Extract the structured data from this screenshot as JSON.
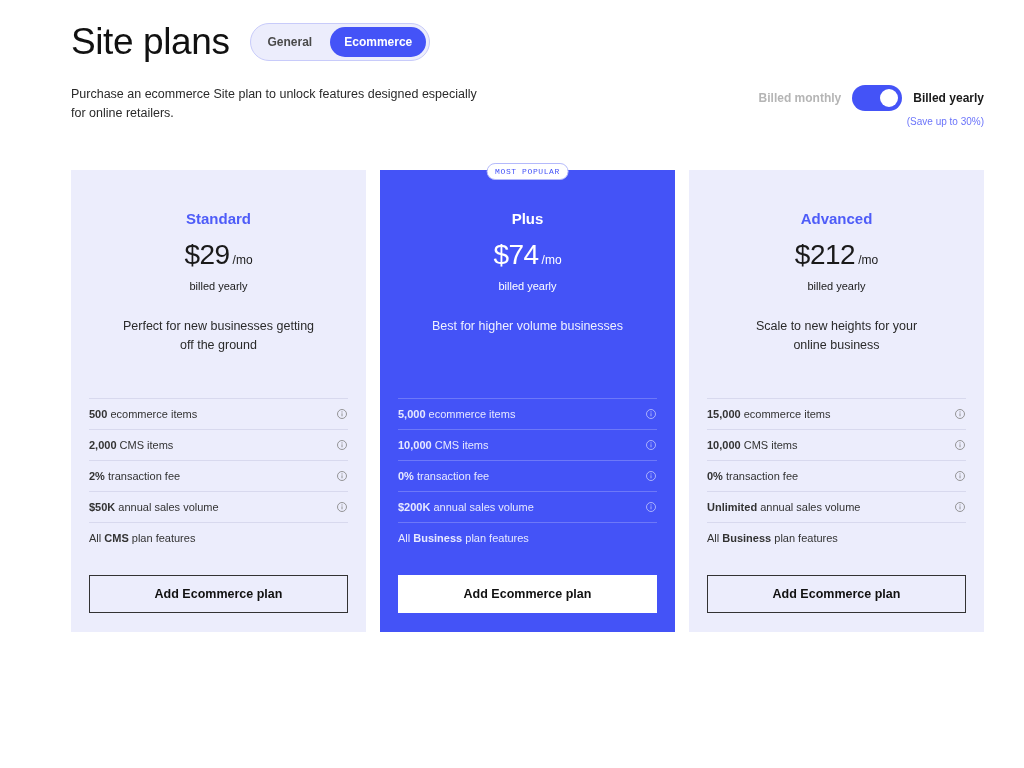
{
  "title": "Site plans",
  "tabs": [
    {
      "label": "General",
      "selected": false
    },
    {
      "label": "Ecommerce",
      "selected": true
    }
  ],
  "description": "Purchase an ecommerce Site plan to unlock features designed especially for online retailers.",
  "billing": {
    "monthly_label": "Billed monthly",
    "yearly": true,
    "yearly_label": "Billed yearly",
    "note": "(Save up to 30%)"
  },
  "plans": [
    {
      "name": "Standard",
      "price": "$29",
      "period": "/mo",
      "billing_note": "billed yearly",
      "description": "Perfect for new businesses getting off the ground",
      "featured": false,
      "features": [
        {
          "text": "**500** ecommerce items",
          "info": true
        },
        {
          "text": "**2,000** CMS items",
          "info": true
        },
        {
          "text": "**2%** transaction fee",
          "info": true
        },
        {
          "text": "**$50K** annual sales volume",
          "info": true
        },
        {
          "text": "All **CMS** plan features",
          "info": false
        }
      ],
      "button": "Add Ecommerce plan"
    },
    {
      "badge": "MOST POPULAR",
      "name": "Plus",
      "price": "$74",
      "period": "/mo",
      "billing_note": "billed yearly",
      "description": "Best for higher volume businesses",
      "featured": true,
      "features": [
        {
          "text": "**5,000** ecommerce items",
          "info": true
        },
        {
          "text": "**10,000** CMS items",
          "info": true
        },
        {
          "text": "**0%** transaction fee",
          "info": true
        },
        {
          "text": "**$200K** annual sales volume",
          "info": true
        },
        {
          "text": "All **Business** plan features",
          "info": false
        }
      ],
      "button": "Add Ecommerce plan"
    },
    {
      "name": "Advanced",
      "price": "$212",
      "period": "/mo",
      "billing_note": "billed yearly",
      "description": "Scale to new heights for your online business",
      "featured": false,
      "features": [
        {
          "text": "**15,000** ecommerce items",
          "info": true
        },
        {
          "text": "**10,000** CMS items",
          "info": true
        },
        {
          "text": "**0%** transaction fee",
          "info": true
        },
        {
          "text": "**Unlimited** annual sales volume",
          "info": true
        },
        {
          "text": "All **Business** plan features",
          "info": false
        }
      ],
      "button": "Add Ecommerce plan"
    }
  ]
}
